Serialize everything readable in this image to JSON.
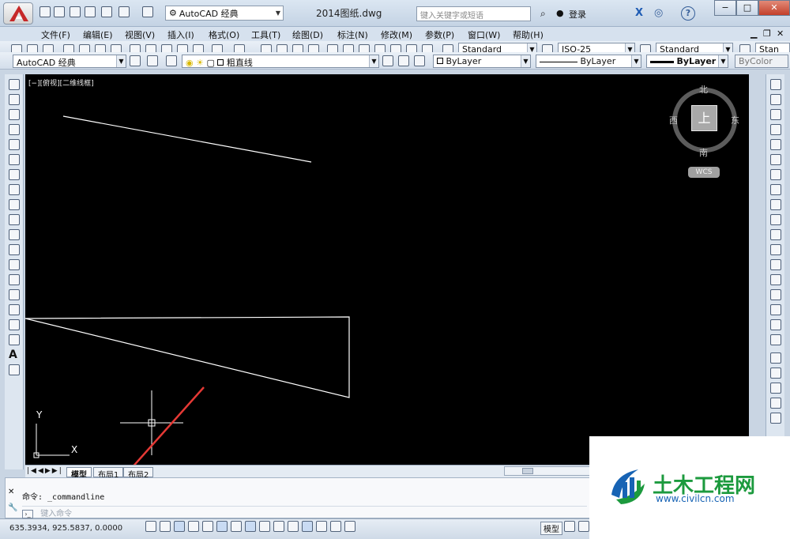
{
  "window": {
    "title": "2014图纸.dwg",
    "workspace": "AutoCAD 经典",
    "search_placeholder": "键入关键字或短语",
    "login_label": "登录",
    "help_label": "?"
  },
  "menu": [
    "文件(F)",
    "编辑(E)",
    "视图(V)",
    "插入(I)",
    "格式(O)",
    "工具(T)",
    "绘图(D)",
    "标注(N)",
    "修改(M)",
    "参数(P)",
    "窗口(W)",
    "帮助(H)"
  ],
  "styles_toolbar": {
    "text_style": "Standard",
    "dim_style": "ISO-25",
    "table_style": "Standard",
    "mleader_style": "Stan"
  },
  "layers_toolbar": {
    "workspace": "AutoCAD 经典",
    "layer": "粗直线",
    "color": "ByLayer",
    "linetype": "ByLayer",
    "lineweight": "ByLayer",
    "plotstyle": "ByColor"
  },
  "viewport": {
    "label": "[−][俯视][二维线框]",
    "viewcube": {
      "top": "上",
      "north": "北",
      "south": "南",
      "east": "东",
      "west": "西",
      "wcs": "WCS"
    },
    "ucs": {
      "x": "X",
      "y": "Y"
    }
  },
  "layout_tabs": [
    "模型",
    "布局1",
    "布局2"
  ],
  "command": {
    "history": "命令: _commandline",
    "input_placeholder": "键入命令"
  },
  "status": {
    "coords": "635.3934, 925.5837, 0.0000",
    "model_label": "模型"
  },
  "watermark": {
    "title": "土木工程网",
    "url": "www.civilcn.com"
  },
  "colors": {
    "canvas_bg": "#000000",
    "geometry": "#ffffff",
    "annotation_arrow": "#e53935",
    "watermark_green": "#1c9a3e",
    "watermark_blue": "#1763b4"
  }
}
